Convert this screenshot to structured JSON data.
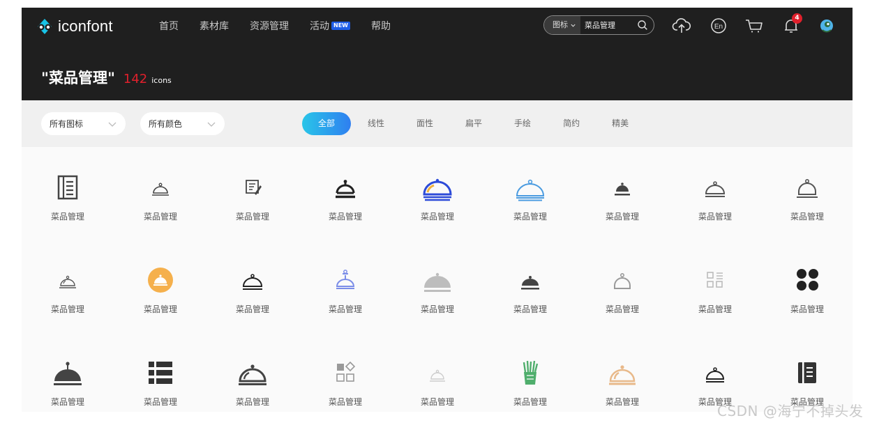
{
  "header": {
    "logo_text": "iconfont",
    "nav": [
      {
        "label": "首页"
      },
      {
        "label": "素材库"
      },
      {
        "label": "资源管理"
      },
      {
        "label": "活动",
        "badge": "NEW"
      },
      {
        "label": "帮助"
      }
    ],
    "search": {
      "type_label": "图标",
      "value": "菜品管理"
    },
    "notifications_count": "4",
    "icons": [
      "upload-cloud-icon",
      "language-en-icon",
      "cart-icon",
      "bell-icon",
      "avatar"
    ]
  },
  "page": {
    "title": "\"菜品管理\"",
    "count": "142",
    "unit": "icons"
  },
  "filters": {
    "dropdowns": [
      {
        "label": "所有图标"
      },
      {
        "label": "所有颜色"
      }
    ],
    "tabs": [
      {
        "label": "全部",
        "active": true
      },
      {
        "label": "线性"
      },
      {
        "label": "面性"
      },
      {
        "label": "扁平"
      },
      {
        "label": "手绘"
      },
      {
        "label": "简约"
      },
      {
        "label": "精美"
      }
    ]
  },
  "icon_label": "菜品管理",
  "icon_grid": [
    {
      "icon": "menu-list-icon",
      "color": "#444444"
    },
    {
      "icon": "cloche-outline-small-icon",
      "color": "#444444"
    },
    {
      "icon": "edit-document-icon",
      "color": "#444444"
    },
    {
      "icon": "cloche-bold-icon",
      "color": "#222222"
    },
    {
      "icon": "cloche-blue-icon",
      "color": "#2d4bd8"
    },
    {
      "icon": "cloche-light-blue-icon",
      "color": "#4a9be0"
    },
    {
      "icon": "cloche-filled-small-icon",
      "color": "#444444"
    },
    {
      "icon": "cloche-outline-icon",
      "color": "#555555"
    },
    {
      "icon": "cloche-outline-tall-icon",
      "color": "#555555"
    },
    {
      "icon": "cloche-thin-icon",
      "color": "#555555"
    },
    {
      "icon": "cloche-orange-circle-icon",
      "color": "#f5b04c"
    },
    {
      "icon": "cloche-outline-icon",
      "color": "#222222"
    },
    {
      "icon": "cloche-violet-icon",
      "color": "#7b8de8"
    },
    {
      "icon": "cloche-gray-filled-icon",
      "color": "#bdbdbd"
    },
    {
      "icon": "cloche-filled-icon",
      "color": "#444444"
    },
    {
      "icon": "cloche-outline-gray-icon",
      "color": "#9a9a9a"
    },
    {
      "icon": "grid-list-icon",
      "color": "#bbbbbb"
    },
    {
      "icon": "four-blobs-icon",
      "color": "#222222"
    },
    {
      "icon": "cloche-filled-large-icon",
      "color": "#444444"
    },
    {
      "icon": "list-bold-icon",
      "color": "#333333"
    },
    {
      "icon": "cloche-large-outline-icon",
      "color": "#444444"
    },
    {
      "icon": "grid-diamond-icon",
      "color": "#999999"
    },
    {
      "icon": "cloche-faint-icon",
      "color": "#cccccc"
    },
    {
      "icon": "vegetables-cup-icon",
      "color": "#4fae6c"
    },
    {
      "icon": "cloche-peach-icon",
      "color": "#e8b98a"
    },
    {
      "icon": "cloche-small-black-icon",
      "color": "#222222"
    },
    {
      "icon": "menu-book-icon",
      "color": "#333333"
    }
  ],
  "watermark": "CSDN @海宁不掉头发"
}
